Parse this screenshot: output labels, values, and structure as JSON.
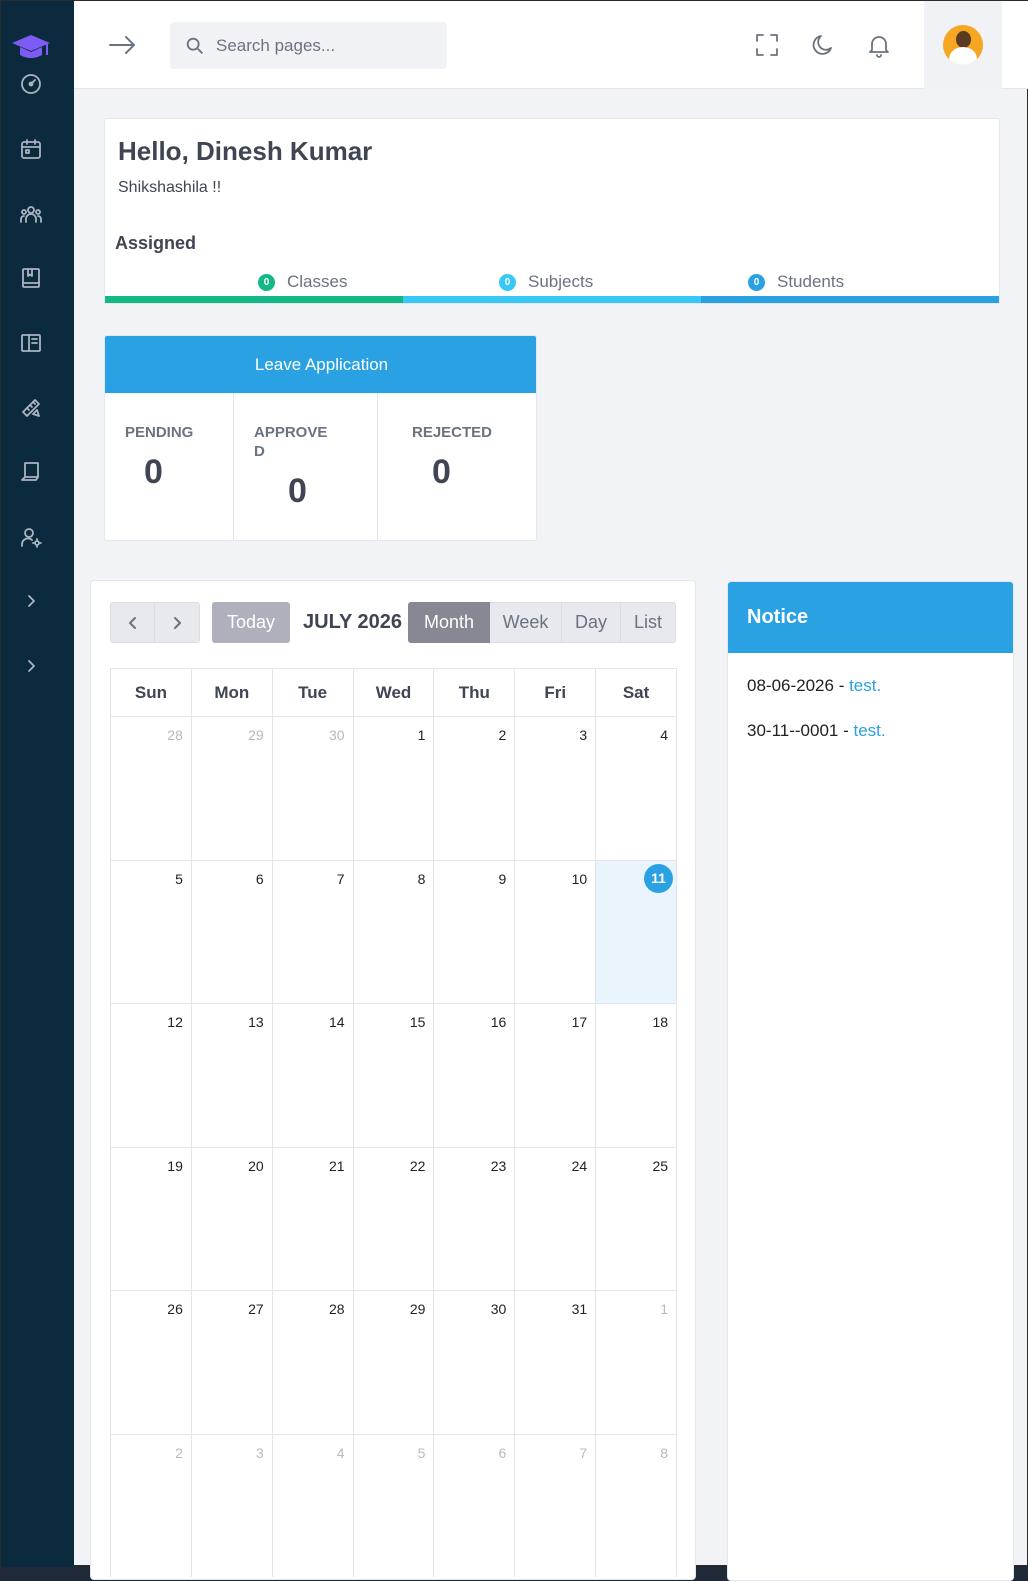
{
  "search": {
    "placeholder": "Search pages..."
  },
  "greeting": {
    "title": "Hello, Dinesh Kumar",
    "subtitle": "Shikshashila !!"
  },
  "assigned": {
    "label": "Assigned",
    "stats": [
      {
        "count": "0",
        "label": "Classes",
        "color": "#12b886"
      },
      {
        "count": "0",
        "label": "Subjects",
        "color": "#38c8f6"
      },
      {
        "count": "0",
        "label": "Students",
        "color": "#2aa1e2"
      }
    ]
  },
  "leave": {
    "title": "Leave Application",
    "pending_label": "PENDING",
    "pending_value": "0",
    "approved_label_1": "APPROVE",
    "approved_label_2": "D",
    "approved_value": "0",
    "rejected_label": "REJECTED",
    "rejected_value": "0"
  },
  "calendar": {
    "title": "JULY 2026",
    "today_label": "Today",
    "views": [
      "Month",
      "Week",
      "Day",
      "List"
    ],
    "active_view": "Month",
    "weekdays": [
      "Sun",
      "Mon",
      "Tue",
      "Wed",
      "Thu",
      "Fri",
      "Sat"
    ],
    "weeks": [
      [
        "28",
        "29",
        "30",
        "1",
        "2",
        "3",
        "4"
      ],
      [
        "5",
        "6",
        "7",
        "8",
        "9",
        "10",
        "11"
      ],
      [
        "12",
        "13",
        "14",
        "15",
        "16",
        "17",
        "18"
      ],
      [
        "19",
        "20",
        "21",
        "22",
        "23",
        "24",
        "25"
      ],
      [
        "26",
        "27",
        "28",
        "29",
        "30",
        "31",
        "1"
      ],
      [
        "2",
        "3",
        "4",
        "5",
        "6",
        "7",
        "8"
      ]
    ],
    "today": "11"
  },
  "notice": {
    "title": "Notice",
    "items": [
      {
        "date": "08-06-2026",
        "separator": " - ",
        "link": "test."
      },
      {
        "date": "30-11--0001",
        "separator": " - ",
        "link": "test."
      }
    ]
  },
  "colors": {
    "sidebar": "#0b2a3d",
    "accent": "#2aa1e2",
    "logo": "#7c5cf5"
  }
}
